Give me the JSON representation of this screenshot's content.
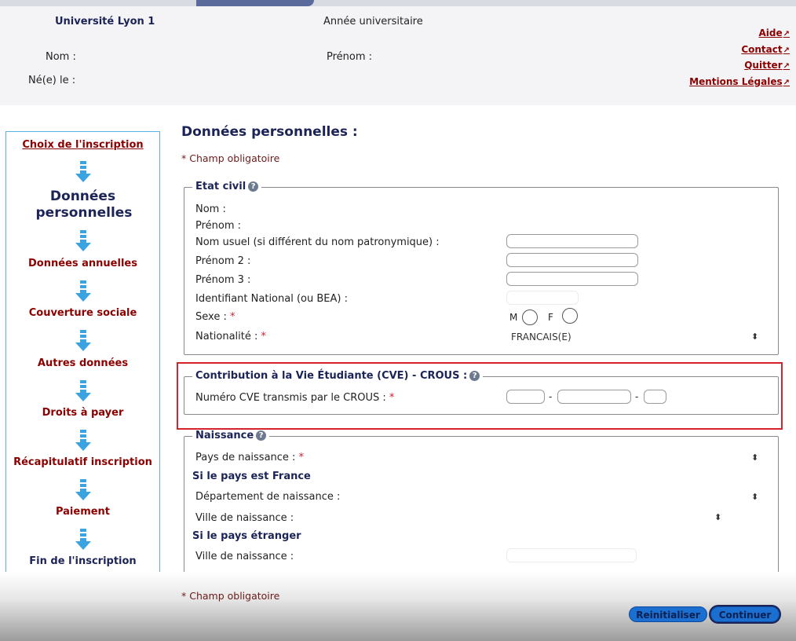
{
  "header": {
    "university": "Université Lyon 1",
    "academic_year_label": "Année universitaire",
    "nom_label": "Nom :",
    "prenom_label": "Prénom :",
    "naissance_label": "Né(e) le :",
    "links": [
      "Aide",
      "Contact",
      "Quitter",
      "Mentions Légales"
    ],
    "link_icon": "↗"
  },
  "sidebar": {
    "steps": [
      {
        "label": "Choix de l'inscription",
        "state": "link"
      },
      {
        "label": "Données personnelles",
        "state": "current"
      },
      {
        "label": "Données annuelles",
        "state": "pending"
      },
      {
        "label": "Couverture sociale",
        "state": "pending"
      },
      {
        "label": "Autres données",
        "state": "pending"
      },
      {
        "label": "Droits à payer",
        "state": "pending"
      },
      {
        "label": "Récapitulatif inscription",
        "state": "pending"
      },
      {
        "label": "Paiement",
        "state": "pending"
      },
      {
        "label": "Fin de l'inscription",
        "state": "final"
      }
    ],
    "arrow_icon": "down-arrow-icon"
  },
  "main": {
    "title": "Données personnelles :",
    "required_note": "Champ obligatoire",
    "required_mark": "*",
    "etat_civil": {
      "legend": "Etat civil",
      "nom": "Nom :",
      "prenom": "Prénom :",
      "nom_usuel": "Nom usuel (si différent du nom patronymique) :",
      "prenom2": "Prénom 2 :",
      "prenom3": "Prénom 3 :",
      "ine": "Identifiant National (ou BEA) :",
      "sexe": "Sexe :",
      "sexe_m": "M",
      "sexe_f": "F",
      "nationalite": "Nationalité :",
      "nationalite_value": "FRANCAIS(E)"
    },
    "cve": {
      "legend": "Contribution à la Vie Étudiante (CVE) - CROUS :",
      "numero": "Numéro CVE transmis par le CROUS :",
      "separator": "-"
    },
    "naissance": {
      "legend": "Naissance",
      "pays": "Pays de naissance :",
      "si_france": "Si le pays est France",
      "departement": "Département de naissance :",
      "ville_fr": "Ville de naissance :",
      "si_etranger": "Si le pays étranger",
      "ville_etr": "Ville de naissance :"
    }
  },
  "buttons": {
    "reset": "Reinitialiser",
    "continue": "Continuer"
  },
  "colors": {
    "navy": "#1c2457",
    "darkred": "#8b0000",
    "sidebar_border": "#5ab0e0",
    "arrow_blue": "#3ba4e0",
    "highlight_red": "#d4232a",
    "button_blue": "#1a6fd0"
  }
}
